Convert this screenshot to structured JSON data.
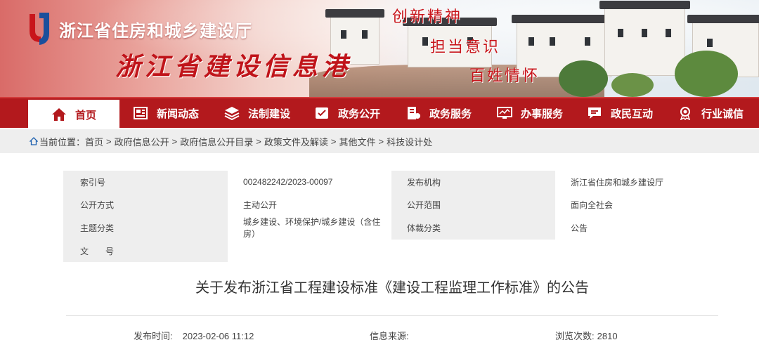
{
  "banner": {
    "org_name": "浙江省住房和城乡建设厅",
    "site_name": "浙江省建设信息港",
    "slogans": [
      "创新精神",
      "担当意识",
      "百姓情怀"
    ]
  },
  "nav": {
    "items": [
      {
        "label": "首页",
        "icon": "home-icon"
      },
      {
        "label": "新闻动态",
        "icon": "newspaper-icon"
      },
      {
        "label": "法制建设",
        "icon": "layers-icon"
      },
      {
        "label": "政务公开",
        "icon": "document-check-icon"
      },
      {
        "label": "政务服务",
        "icon": "service-icon"
      },
      {
        "label": "办事服务",
        "icon": "monitor-icon"
      },
      {
        "label": "政民互动",
        "icon": "chat-icon"
      },
      {
        "label": "行业诚信",
        "icon": "award-icon"
      }
    ]
  },
  "breadcrumb": {
    "prefix": "当前位置：",
    "items": [
      "首页",
      "政府信息公开",
      "政府信息公开目录",
      "政策文件及解读",
      "其他文件",
      "科技设计处"
    ],
    "separator": ">"
  },
  "meta": {
    "index_label": "索引号",
    "index_value": "002482242/2023-00097",
    "publisher_label": "发布机构",
    "publisher_value": "浙江省住房和城乡建设厅",
    "mode_label": "公开方式",
    "mode_value": "主动公开",
    "scope_label": "公开范围",
    "scope_value": "面向全社会",
    "topic_label": "主题分类",
    "topic_value": "城乡建设、环境保护/城乡建设（含住房）",
    "genre_label": "体裁分类",
    "genre_value": "公告",
    "docno_label": "文　　号",
    "docno_value": ""
  },
  "document": {
    "title": "关于发布浙江省工程建设标准《建设工程监理工作标准》的公告",
    "publish_time_label": "发布时间:",
    "publish_time": "2023-02-06 11:12",
    "source_label": "信息来源:",
    "source_value": "",
    "views_label": "浏览次数:",
    "views": "2810"
  },
  "colors": {
    "primary_red": "#b3191d",
    "slogan_red": "#c8151b",
    "gray_bg": "#eeeeee"
  }
}
